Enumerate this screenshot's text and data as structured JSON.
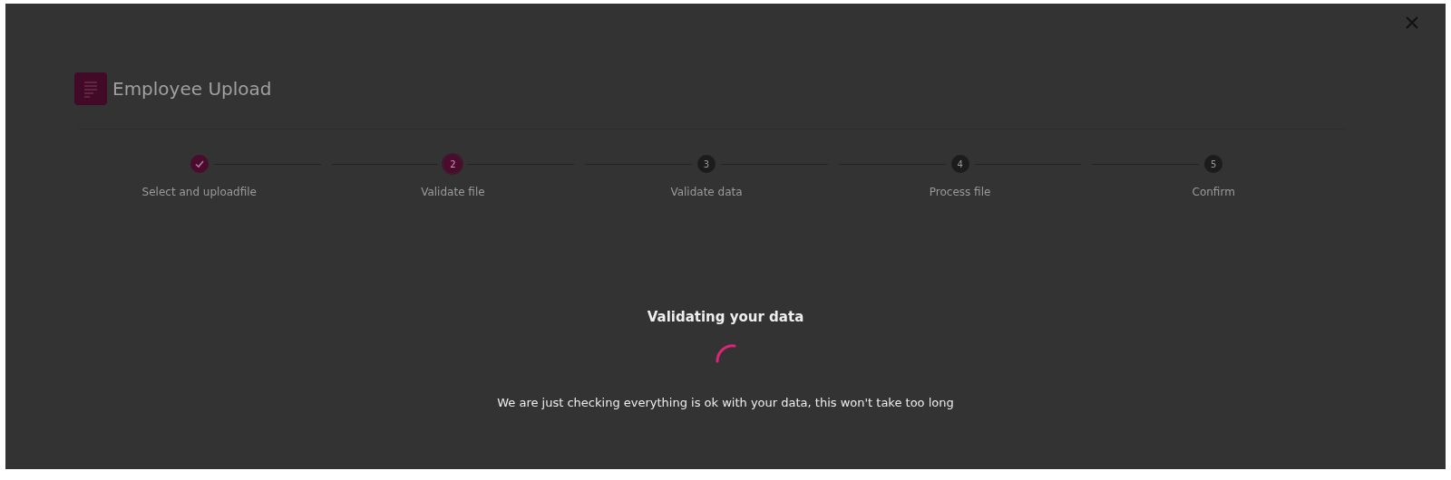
{
  "header": {
    "title": "Employee Upload"
  },
  "steps": [
    {
      "completed": true,
      "selected": false,
      "label": "Select and uploadfile"
    },
    {
      "completed": false,
      "selected": true,
      "number": "2",
      "label": "Validate file"
    },
    {
      "completed": false,
      "selected": false,
      "number": "3",
      "label": "Validate data"
    },
    {
      "completed": false,
      "selected": false,
      "number": "4",
      "label": "Process file"
    },
    {
      "completed": false,
      "selected": false,
      "number": "5",
      "label": "Confirm"
    }
  ],
  "loading": {
    "title": "Validating your data",
    "message": "We are just checking everything is ok with your data, this won't take too long"
  }
}
